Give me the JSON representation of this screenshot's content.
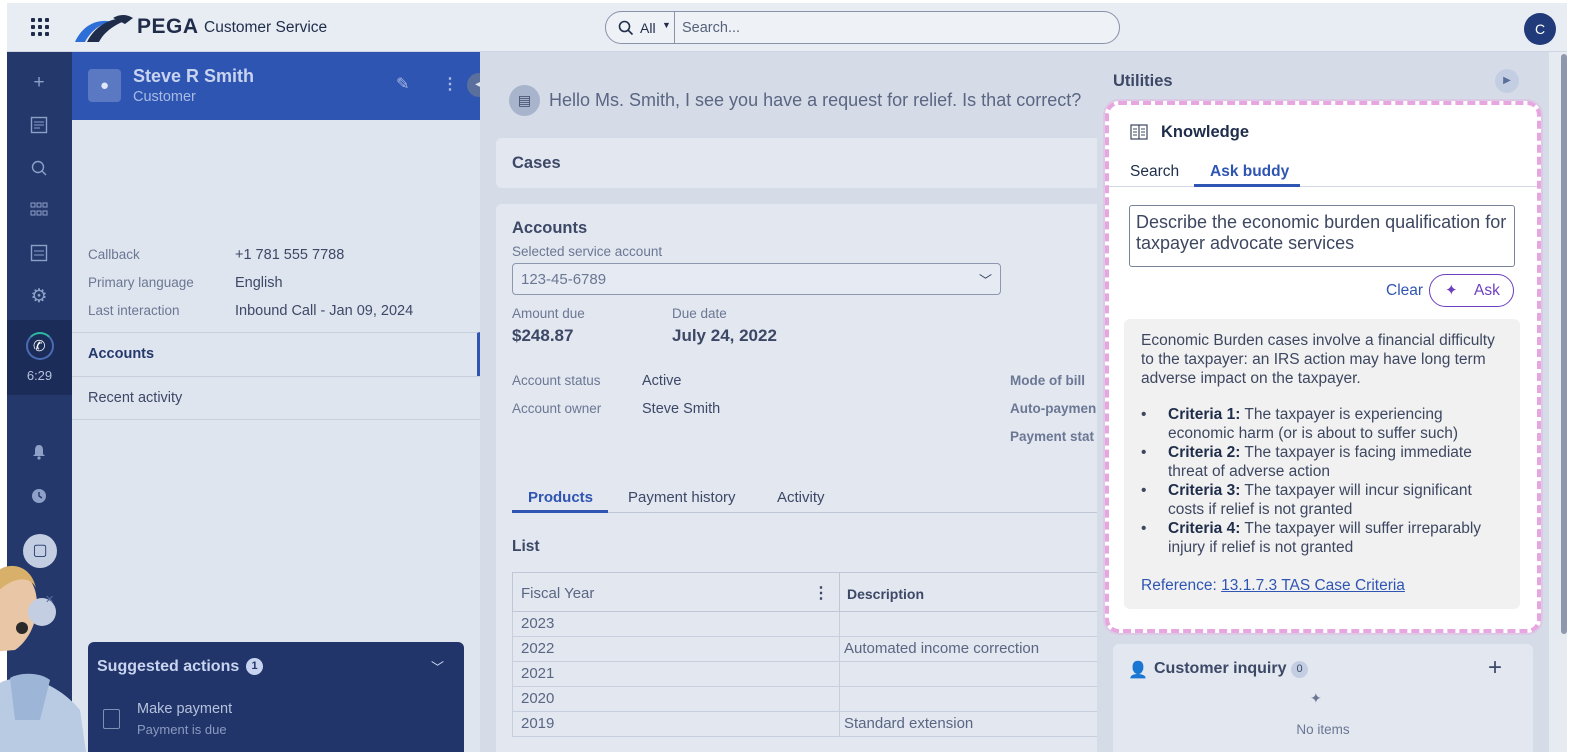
{
  "header": {
    "brand": "PEGA",
    "app_name": "Customer Service",
    "search_scope": "All",
    "search_placeholder": "Search...",
    "user_initial": "C"
  },
  "rail": {
    "call_timer": "6:29"
  },
  "customer": {
    "name": "Steve R Smith",
    "role": "Customer",
    "fields": [
      {
        "label": "Callback",
        "value": "+1 781 555 7788"
      },
      {
        "label": "Primary language",
        "value": "English"
      },
      {
        "label": "Last interaction",
        "value": "Inbound Call - Jan 09, 2024"
      }
    ],
    "nav": [
      {
        "label": "Accounts"
      },
      {
        "label": "Recent activity"
      }
    ],
    "suggested": {
      "title": "Suggested actions",
      "count": "1",
      "item_title": "Make payment",
      "item_subtitle": "Payment is due"
    }
  },
  "center": {
    "script": "Hello Ms. Smith, I see you have a request for relief. Is that correct?",
    "cases_title": "Cases",
    "accounts": {
      "title": "Accounts",
      "select_label": "Selected service account",
      "select_value": "123-45-6789",
      "amount_due_label": "Amount due",
      "amount_due": "$248.87",
      "due_date_label": "Due date",
      "due_date": "July 24, 2022",
      "status_label": "Account status",
      "status": "Active",
      "owner_label": "Account owner",
      "owner": "Steve Smith",
      "mode_label": "Mode of bill",
      "autopay_label": "Auto-paymen",
      "paystat_label": "Payment stat"
    },
    "tabs": [
      "Products",
      "Payment history",
      "Activity"
    ],
    "list_title": "List",
    "columns": [
      "Fiscal Year",
      "Description"
    ],
    "rows": [
      {
        "year": "2023",
        "desc": ""
      },
      {
        "year": "2022",
        "desc": "Automated income correction"
      },
      {
        "year": "2021",
        "desc": ""
      },
      {
        "year": "2020",
        "desc": ""
      },
      {
        "year": "2019",
        "desc": "Standard extension"
      }
    ]
  },
  "utilities": {
    "title": "Utilities",
    "knowledge": {
      "title": "Knowledge",
      "tabs": [
        "Search",
        "Ask buddy"
      ],
      "question": "Describe the economic burden qualification for taxpayer advocate services",
      "clear_label": "Clear",
      "ask_label": "Ask",
      "answer_intro": "Economic Burden cases involve a financial difficulty to the taxpayer: an IRS action may have long term adverse impact on the taxpayer.",
      "criteria": [
        {
          "label": "Criteria 1:",
          "text": "The taxpayer is experiencing economic harm (or is about to suffer such)"
        },
        {
          "label": "Criteria 2:",
          "text": "The taxpayer is facing immediate threat of adverse action"
        },
        {
          "label": "Criteria 3:",
          "text": "The taxpayer will incur significant costs if relief is not granted"
        },
        {
          "label": "Criteria 4:",
          "text": "The taxpayer will suffer irreparably injury if relief is not granted"
        }
      ],
      "reference_label": "Reference:",
      "reference_link": "13.1.7.3 TAS Case Criteria"
    },
    "inquiry": {
      "title": "Customer inquiry",
      "count": "0",
      "empty": "No items"
    }
  }
}
